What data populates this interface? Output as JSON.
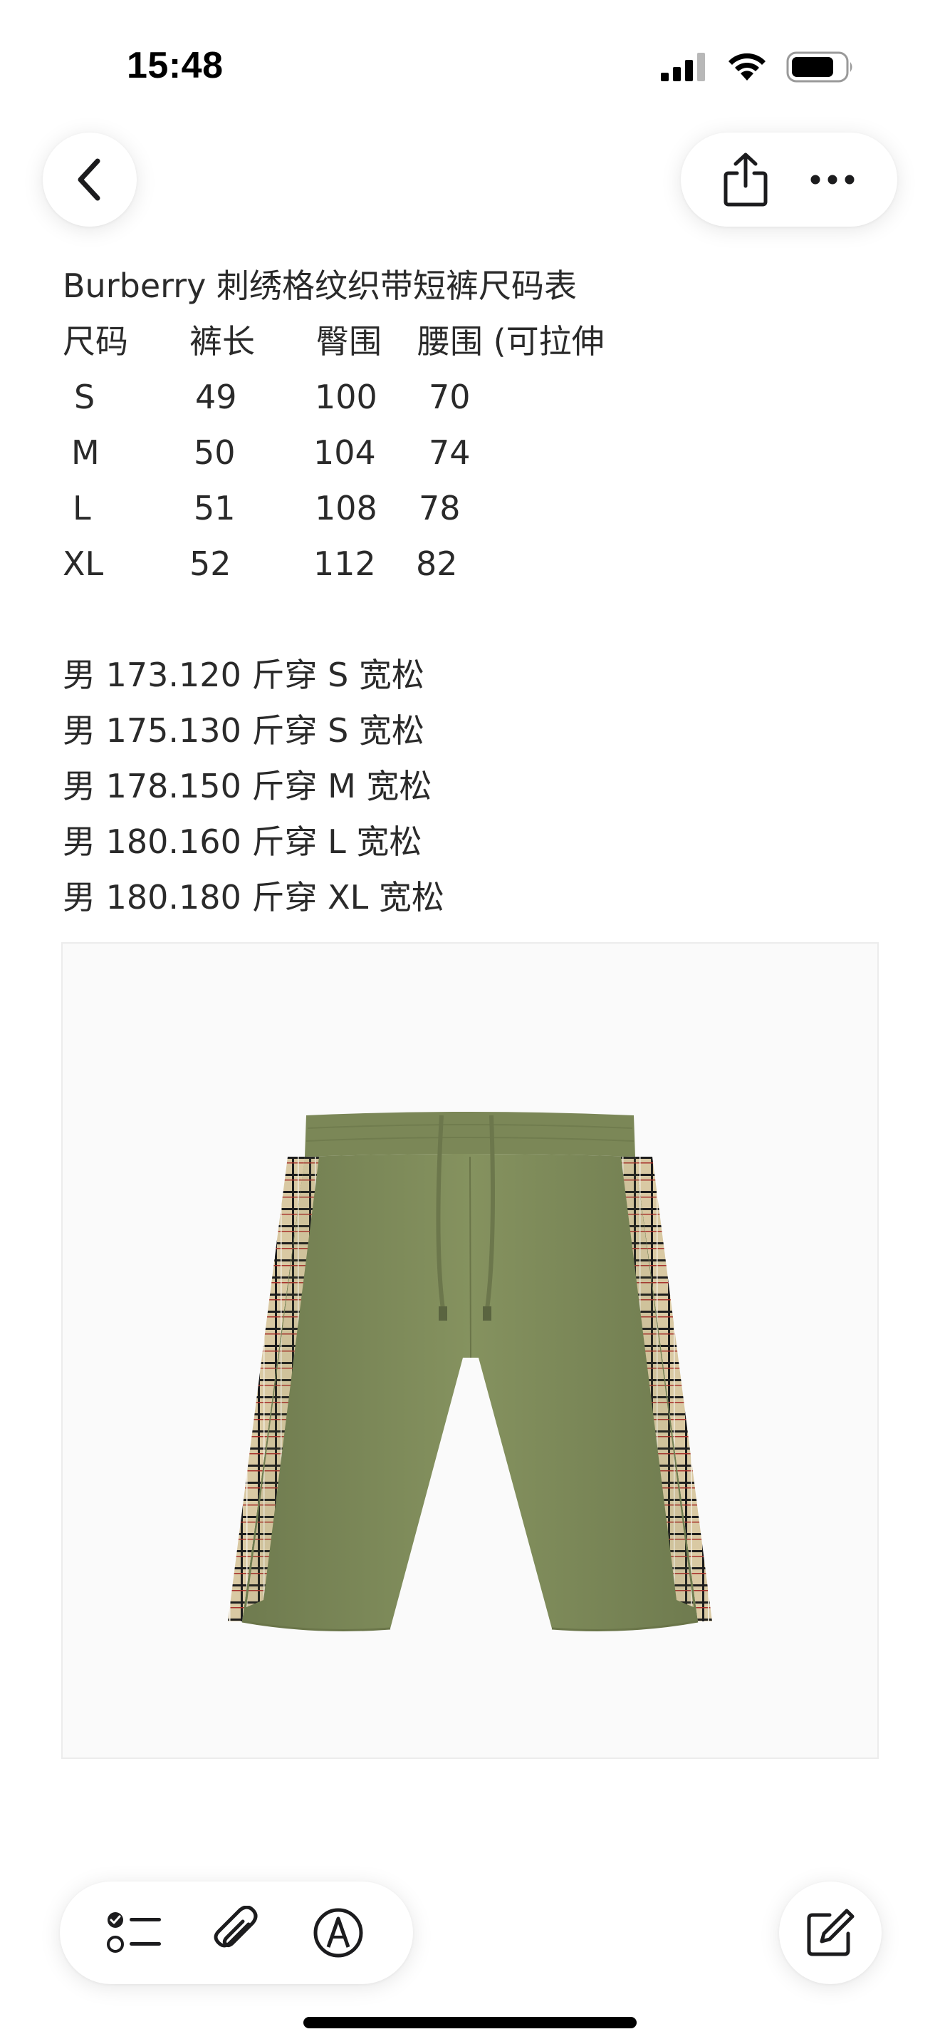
{
  "status_bar": {
    "time": "15:48",
    "battery_level": 0.8
  },
  "toolbar": {
    "back_icon": "chevron-left-icon",
    "share_icon": "share-icon",
    "more_icon": "ellipsis-icon"
  },
  "note": {
    "title": "Burberry 刺绣格纹织带短裤尺码表",
    "table_header": [
      "尺码",
      "裤长",
      "臀围",
      "腰围 (可拉伸"
    ],
    "table_rows": [
      [
        "S",
        "49",
        "100",
        "70"
      ],
      [
        "M",
        "50",
        "104",
        "74"
      ],
      [
        "L",
        "51",
        "108",
        "78"
      ],
      [
        "XL",
        "52",
        "112",
        "82"
      ]
    ],
    "fit_lines": [
      "男 173.120 斤穿 S 宽松",
      "男 175.130 斤穿 S 宽松",
      "男 178.150 斤穿 M 宽松",
      "男 180.160 斤穿 L 宽松",
      "男 180.180 斤穿 XL 宽松"
    ]
  },
  "bottom_toolbar": {
    "checklist_icon": "checklist-icon",
    "attachment_icon": "paperclip-icon",
    "markup_icon": "pen-markup-icon",
    "compose_icon": "compose-icon"
  },
  "colors": {
    "short_green": "#7f8c5d",
    "text": "#2a2a2a"
  }
}
